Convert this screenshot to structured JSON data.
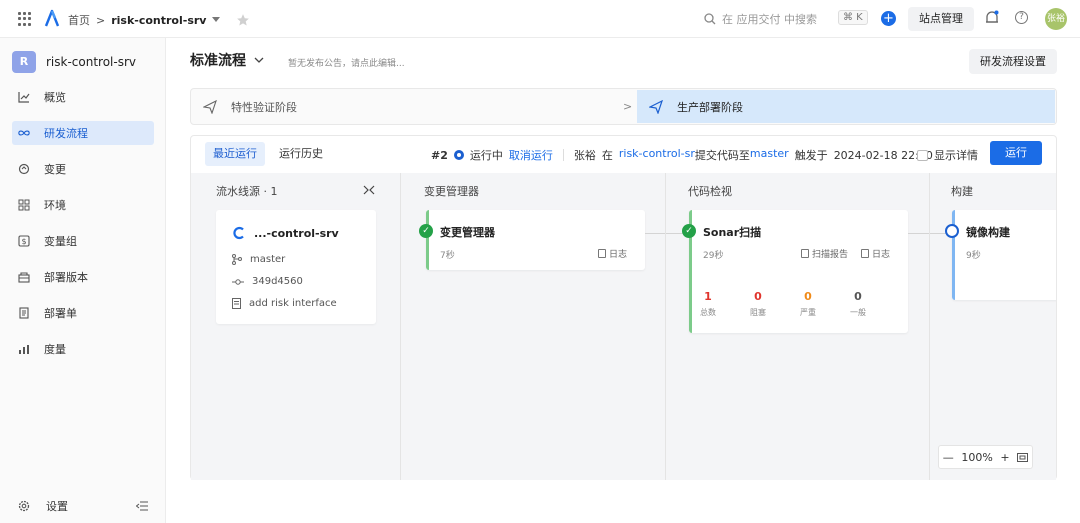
{
  "topbar": {
    "breadcrumb_home": "首页",
    "breadcrumb_sep": ">",
    "project": "risk-control-srv",
    "search_placeholder": "在 应用交付 中搜索",
    "shortcut": "⌘ K",
    "site_admin": "站点管理",
    "avatar_text": "张裕"
  },
  "sidebar": {
    "project_initial": "R",
    "project_name": "risk-control-srv",
    "items": [
      {
        "label": "概览",
        "icon": "chart-line-icon"
      },
      {
        "label": "研发流程",
        "icon": "infinity-icon",
        "active": true
      },
      {
        "label": "变更",
        "icon": "refresh-icon"
      },
      {
        "label": "环境",
        "icon": "grid-icon"
      },
      {
        "label": "变量组",
        "icon": "dollar-icon"
      },
      {
        "label": "部署版本",
        "icon": "package-icon"
      },
      {
        "label": "部署单",
        "icon": "document-icon"
      },
      {
        "label": "度量",
        "icon": "bar-chart-icon"
      }
    ],
    "settings": "设置"
  },
  "header": {
    "title": "标准流程",
    "notice": "暂无发布公告，请点此编辑...",
    "settings_button": "研发流程设置"
  },
  "stages": {
    "stage1": "特性验证阶段",
    "stage2": "生产部署阶段"
  },
  "run": {
    "tab_recent": "最近运行",
    "tab_history": "运行历史",
    "number": "#2",
    "status": "运行中",
    "cancel": "取消运行",
    "user": "张裕",
    "in_word": "在",
    "repo": "risk-control-sr",
    "commit_text": "提交代码至",
    "branch": "master",
    "trigger_text": "触发于",
    "time": "2024-02-18 22:20",
    "show_detail": "显示详情",
    "run_button": "运行"
  },
  "pipeline": {
    "source_col": "流水线源 · 1",
    "source": {
      "repo": "...-control-srv",
      "branch": "master",
      "commit": "349d4560",
      "message": "add risk interface"
    },
    "columns": [
      "变更管理器",
      "代码检视",
      "构建"
    ],
    "jobs": [
      {
        "name": "变更管理器",
        "duration": "7秒",
        "log": "日志"
      },
      {
        "name": "Sonar扫描",
        "duration": "29秒",
        "report": "扫描报告",
        "log": "日志",
        "stats": [
          {
            "value": "1",
            "label": "总数",
            "color": "#e0342c"
          },
          {
            "value": "0",
            "label": "阻塞",
            "color": "#e0342c"
          },
          {
            "value": "0",
            "label": "严重",
            "color": "#f08a18"
          },
          {
            "value": "0",
            "label": "一般",
            "color": "#555555"
          }
        ]
      },
      {
        "name": "镜像构建",
        "duration": "9秒"
      }
    ],
    "zoom": "100%"
  }
}
